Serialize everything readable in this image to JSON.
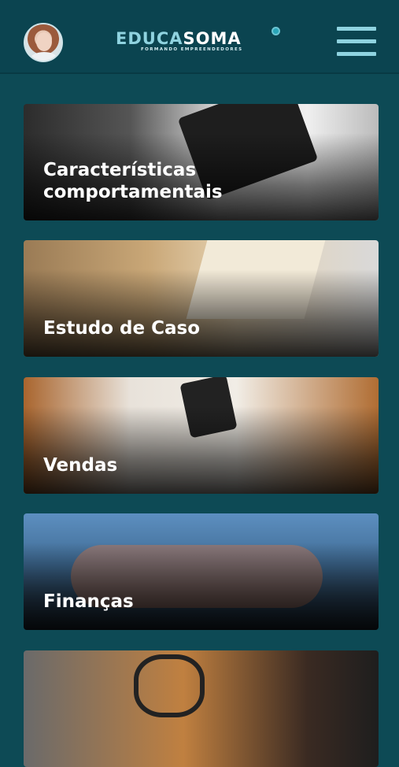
{
  "brand": {
    "name_part1": "EDUCA",
    "name_part2": "SOMA",
    "tagline": "FORMANDO EMPREENDEDORES"
  },
  "cards": [
    {
      "label": "Características comportamentais"
    },
    {
      "label": "Estudo de Caso"
    },
    {
      "label": "Vendas"
    },
    {
      "label": "Finanças"
    },
    {
      "label": ""
    }
  ],
  "colors": {
    "background": "#0d4a55",
    "accent": "#8fd3e0"
  }
}
